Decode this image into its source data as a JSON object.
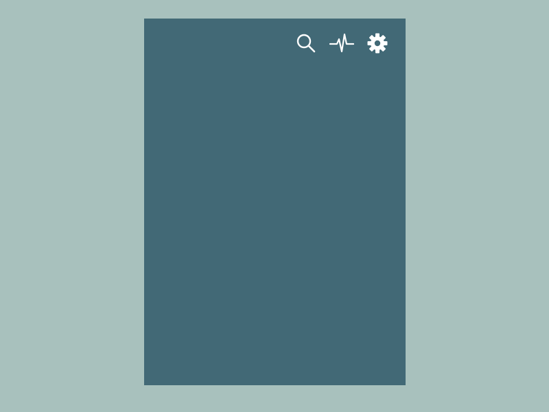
{
  "colors": {
    "background": "#a8c1bd",
    "panel": "#426976",
    "icon": "#ffffff"
  },
  "toolbar": {
    "icons": [
      "search-icon",
      "activity-icon",
      "gear-icon"
    ]
  }
}
